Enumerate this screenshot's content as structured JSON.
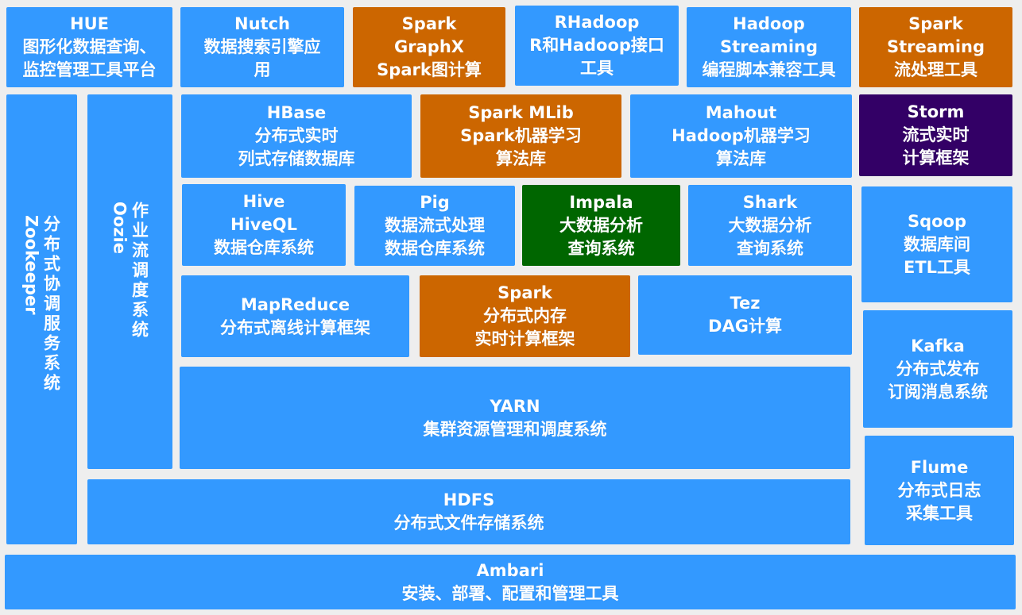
{
  "colors": {
    "background": "#eeeeee",
    "blue": "#3399ff",
    "orange": "#cc6600",
    "purple": "#330066",
    "green": "#006600",
    "text": "#ffffff"
  },
  "blocks": {
    "hue": {
      "lines": [
        "HUE",
        "图形化数据查询、",
        "监控管理工具平台"
      ]
    },
    "nutch": {
      "lines": [
        "Nutch",
        "数据搜索引擎应",
        "用"
      ]
    },
    "graphx": {
      "lines": [
        "Spark",
        "GraphX",
        "Spark图计算"
      ]
    },
    "rhadoop": {
      "lines": [
        "RHadoop",
        "R和Hadoop接口",
        "工具"
      ]
    },
    "streaming": {
      "lines": [
        "Hadoop",
        "Streaming",
        "编程脚本兼容工具"
      ]
    },
    "sparkstreaming": {
      "lines": [
        "Spark",
        "Streaming",
        "流处理工具"
      ]
    },
    "zookeeper": {
      "latin": "Zookeeper",
      "cjk": "分布式协调服务系统"
    },
    "oozie": {
      "latin": "Oozie",
      "cjk": "作业流调度系统"
    },
    "hbase": {
      "lines": [
        "HBase",
        "分布式实时",
        "列式存储数据库"
      ]
    },
    "mlib": {
      "lines": [
        "Spark MLib",
        "Spark机器学习",
        "算法库"
      ]
    },
    "mahout": {
      "lines": [
        "Mahout",
        "Hadoop机器学习",
        "算法库"
      ]
    },
    "storm": {
      "lines": [
        "Storm",
        "流式实时",
        "计算框架"
      ]
    },
    "hive": {
      "lines": [
        "Hive",
        "HiveQL",
        "数据仓库系统"
      ]
    },
    "pig": {
      "lines": [
        "Pig",
        "数据流式处理",
        "数据仓库系统"
      ]
    },
    "impala": {
      "lines": [
        "Impala",
        "大数据分析",
        "查询系统"
      ]
    },
    "shark": {
      "lines": [
        "Shark",
        "大数据分析",
        "查询系统"
      ]
    },
    "sqoop": {
      "lines": [
        "Sqoop",
        "数据库间",
        "ETL工具"
      ]
    },
    "mapreduce": {
      "lines": [
        "MapReduce",
        "分布式离线计算框架"
      ]
    },
    "spark": {
      "lines": [
        "Spark",
        "分布式内存",
        "实时计算框架"
      ]
    },
    "tez": {
      "lines": [
        "Tez",
        "DAG计算"
      ]
    },
    "kafka": {
      "lines": [
        "Kafka",
        "分布式发布",
        "订阅消息系统"
      ]
    },
    "yarn": {
      "lines": [
        "YARN",
        "集群资源管理和调度系统"
      ]
    },
    "flume": {
      "lines": [
        "Flume",
        "分布式日志",
        "采集工具"
      ]
    },
    "hdfs": {
      "lines": [
        "HDFS",
        "分布式文件存储系统"
      ]
    },
    "ambari": {
      "lines": [
        "Ambari",
        "安装、部署、配置和管理工具"
      ]
    }
  }
}
